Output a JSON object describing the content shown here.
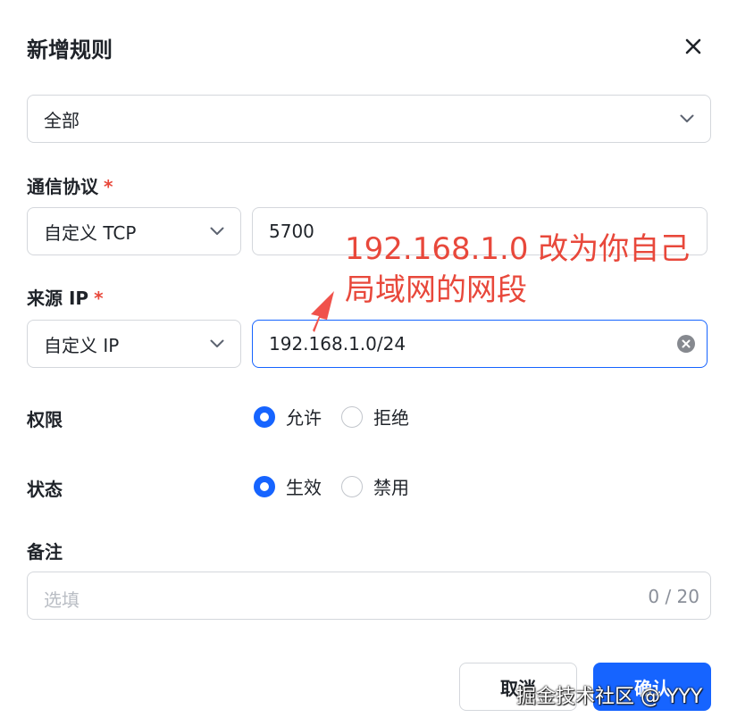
{
  "dialog": {
    "title": "新增规则",
    "close_icon": "close-icon"
  },
  "scope": {
    "selected": "全部",
    "icon": "chevron-down-icon"
  },
  "protocol": {
    "label": "通信协议",
    "required_mark": "*",
    "type_selected": "自定义 TCP",
    "port_value": "5700"
  },
  "source_ip": {
    "label": "来源 IP",
    "required_mark": "*",
    "type_selected": "自定义 IP",
    "value": "192.168.1.0/24",
    "clear_icon": "clear-circle-icon"
  },
  "permission": {
    "label": "权限",
    "options": [
      "允许",
      "拒绝"
    ],
    "selected_index": 0
  },
  "status": {
    "label": "状态",
    "options": [
      "生效",
      "禁用"
    ],
    "selected_index": 0
  },
  "remark": {
    "label": "备注",
    "placeholder": "选填",
    "counter": "0 / 20"
  },
  "footer": {
    "cancel_label": "取消",
    "ok_label": "确认"
  },
  "annotation": {
    "line1": "192.168.1.0 改为你自己",
    "line2": "局域网的网段",
    "color": "#e8483b"
  },
  "watermark": "掘金技术社区 @ YYY",
  "colors": {
    "accent": "#1664ff",
    "required": "#e8483b",
    "border": "#d4d7dc"
  }
}
